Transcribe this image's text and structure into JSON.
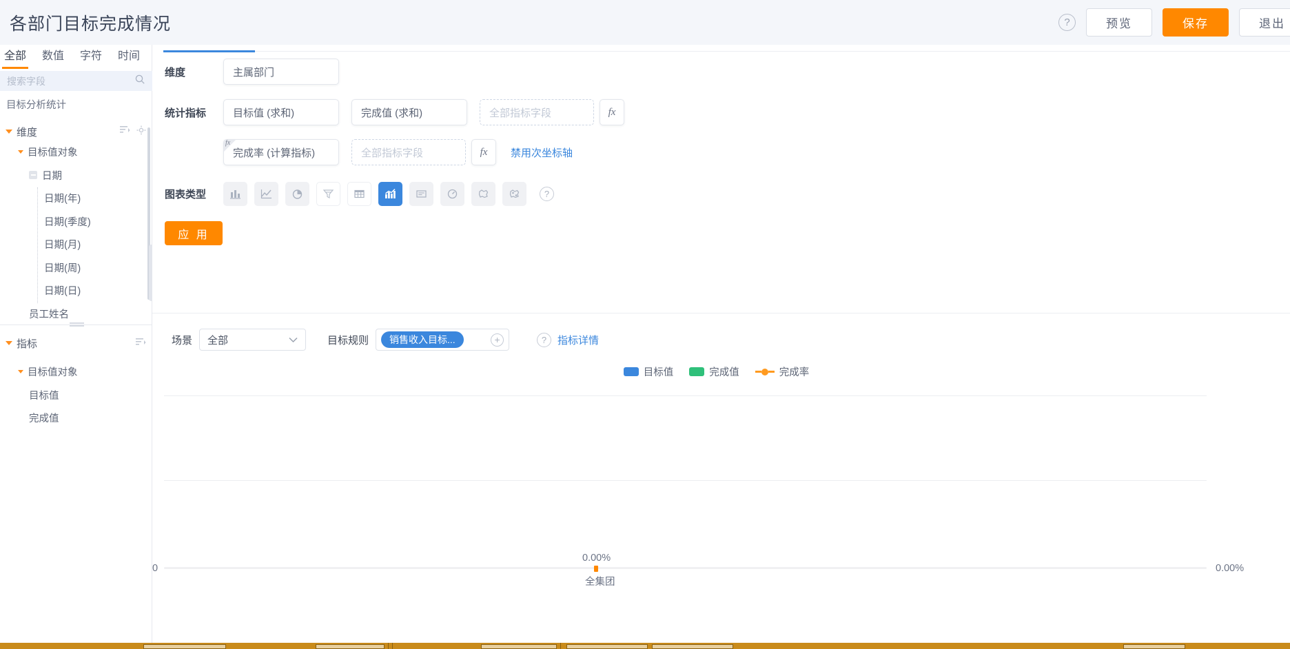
{
  "header": {
    "title": "各部门目标完成情况",
    "help_icon": "help-icon",
    "preview_label": "预览",
    "save_label": "保存",
    "exit_label": "退出",
    "save_color": "#ff8800"
  },
  "sidebar": {
    "tabs": [
      {
        "label": "全部",
        "active": true
      },
      {
        "label": "数值",
        "active": false
      },
      {
        "label": "字符",
        "active": false
      },
      {
        "label": "时间",
        "active": false
      }
    ],
    "search": {
      "placeholder": "搜索字段",
      "value": "",
      "icon": "search-icon"
    },
    "dataset_name": "目标分析统计",
    "dimension_section": {
      "title": "维度",
      "nodes": [
        {
          "label": "目标值对象",
          "level": 1,
          "marker": "caret"
        },
        {
          "label": "日期",
          "level": 2,
          "marker": "minus"
        },
        {
          "label": "日期(年)",
          "level": 3,
          "marker": "none"
        },
        {
          "label": "日期(季度)",
          "level": 3,
          "marker": "none"
        },
        {
          "label": "日期(月)",
          "level": 3,
          "marker": "none"
        },
        {
          "label": "日期(周)",
          "level": 3,
          "marker": "none"
        },
        {
          "label": "日期(日)",
          "level": 3,
          "marker": "none"
        },
        {
          "label": "员工姓名",
          "level": 2,
          "marker": "none"
        }
      ]
    },
    "metric_section": {
      "title": "指标",
      "nodes": [
        {
          "label": "目标值对象",
          "level": 1,
          "marker": "caret"
        },
        {
          "label": "目标值",
          "level": 2,
          "marker": "none"
        },
        {
          "label": "完成值",
          "level": 2,
          "marker": "none"
        }
      ]
    }
  },
  "form": {
    "dimension": {
      "label": "维度",
      "fields": [
        {
          "value": "主属部门",
          "type": "filled"
        }
      ]
    },
    "metrics": {
      "label": "统计指标",
      "row1": [
        {
          "value": "目标值 (求和)",
          "type": "filled"
        },
        {
          "value": "完成值 (求和)",
          "type": "filled"
        },
        {
          "value": "",
          "placeholder": "全部指标字段",
          "type": "dashed"
        }
      ],
      "fx_button_label": "fx",
      "row2": [
        {
          "value": "完成率 (计算指标)",
          "type": "filled",
          "badge": "fx"
        },
        {
          "value": "",
          "placeholder": "全部指标字段",
          "type": "dashed"
        }
      ],
      "secondary_axis_link": "禁用次坐标轴"
    },
    "chart_type": {
      "label": "图表类型",
      "options": [
        {
          "name": "bar-chart-icon",
          "selected": false,
          "style": "grey"
        },
        {
          "name": "line-chart-icon",
          "selected": false,
          "style": "grey"
        },
        {
          "name": "pie-chart-icon",
          "selected": false,
          "style": "grey"
        },
        {
          "name": "funnel-chart-icon",
          "selected": false,
          "style": "light"
        },
        {
          "name": "table-icon",
          "selected": false,
          "style": "light"
        },
        {
          "name": "combo-chart-icon",
          "selected": true,
          "style": "selected"
        },
        {
          "name": "text-card-icon",
          "selected": false,
          "style": "grey"
        },
        {
          "name": "gauge-chart-icon",
          "selected": false,
          "style": "grey"
        },
        {
          "name": "map-chart-icon",
          "selected": false,
          "style": "grey"
        },
        {
          "name": "map-scatter-icon",
          "selected": false,
          "style": "grey"
        }
      ],
      "help_icon": "help-icon"
    },
    "apply_label": "应 用"
  },
  "scene_bar": {
    "scene_label": "场景",
    "scene_value": "全部",
    "rule_label": "目标规则",
    "rule_chip": "销售收入目标...",
    "add_icon": "plus-circle-icon",
    "help_icon": "help-icon",
    "detail_link": "指标详情"
  },
  "chart_data": {
    "type": "bar",
    "title": "",
    "categories": [
      "全集团"
    ],
    "series": [
      {
        "name": "目标值",
        "color": "#3b87dd",
        "values": [
          0
        ]
      },
      {
        "name": "完成值",
        "color": "#2fc07a",
        "values": [
          0
        ]
      },
      {
        "name": "完成率",
        "color": "#ff8800",
        "values": [
          0
        ],
        "axis": "secondary",
        "kind": "line"
      }
    ],
    "legend": [
      {
        "label": "目标值",
        "color": "#3b87dd",
        "marker": "square"
      },
      {
        "label": "完成值",
        "color": "#2fc07a",
        "marker": "square"
      },
      {
        "label": "完成率",
        "color": "#ff8800",
        "marker": "line-dot"
      }
    ],
    "data_labels": [
      "0.00%"
    ],
    "y_left_ticks": [
      "0"
    ],
    "y_right_ticks": [
      "0.00%"
    ],
    "xlabel": "",
    "ylabel": "",
    "legend_position": "top-center",
    "grid": true
  }
}
